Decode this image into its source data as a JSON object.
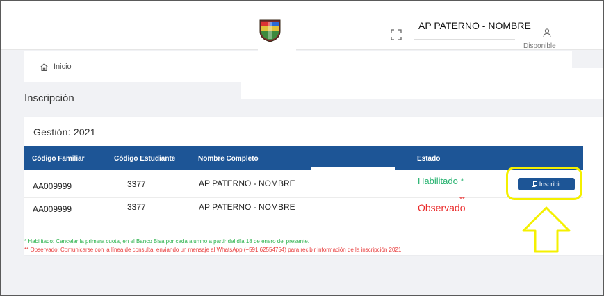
{
  "header": {
    "user_name": "AP PATERNO - NOMBRE",
    "user_status": "Disponible",
    "icons": {
      "fullscreen": "fullscreen-icon",
      "user": "user-icon",
      "crest": "school-crest"
    }
  },
  "breadcrumb": {
    "home_label": "Inicio",
    "icon": "home-icon"
  },
  "page": {
    "title": "Inscripción"
  },
  "card": {
    "title": "Gestión: 2021",
    "columns": [
      "Código Familiar",
      "Código Estudiante",
      "Nombre Completo",
      "Estado"
    ],
    "rows": [
      {
        "familia": "AA009999",
        "estudiante": "3377",
        "nombre": "AP PATERNO - NOMBRE",
        "estado": "Habilitado *",
        "action": "Inscribir"
      },
      {
        "familia": "AA009999",
        "estudiante": "3377",
        "nombre": "AP PATERNO - NOMBRE",
        "estado": "Observado",
        "estado_mark": "**"
      }
    ],
    "notes": {
      "habilitado": "* Habilitado: Cancelar la primera cuota, en el Banco Bisa por cada alumno a partir del día 18 de enero del presente.",
      "observado": "** Observado: Comunicarse con la línea de consulta, enviando un mensaje al WhatsApp (+591 62554754) para recibir información de la inscripción 2021."
    }
  },
  "colors": {
    "header_blue": "#1d5596",
    "status_ok": "#26b26f",
    "status_observed": "#ea2b2b",
    "highlight": "#f4f000"
  }
}
